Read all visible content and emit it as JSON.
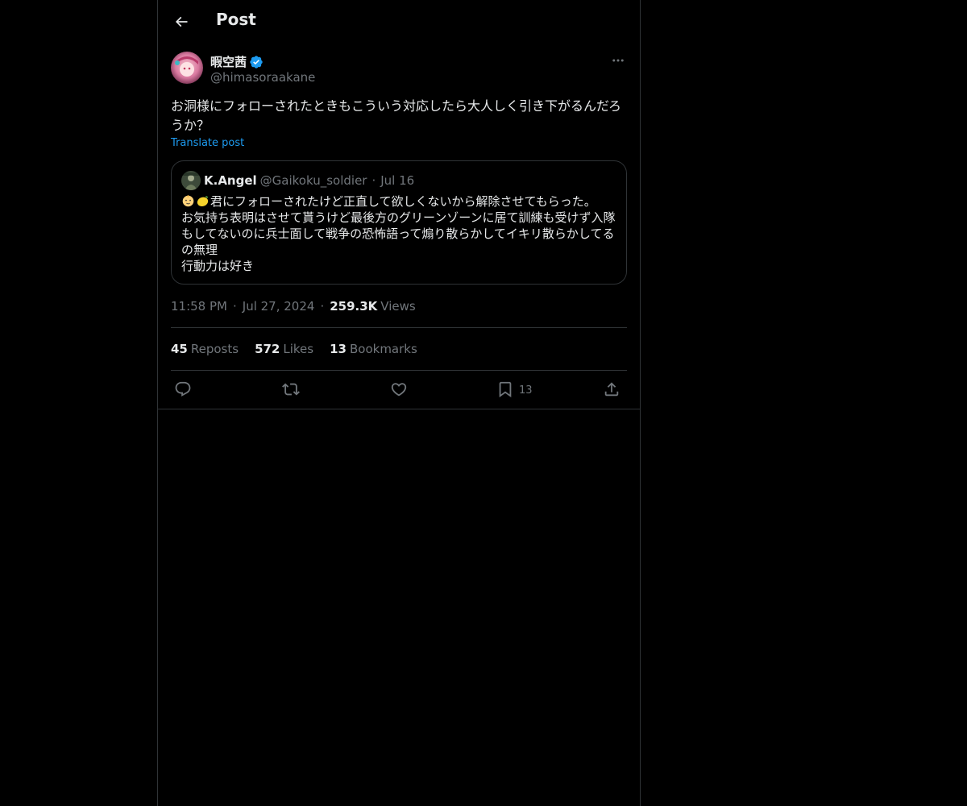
{
  "header": {
    "title": "Post"
  },
  "post": {
    "author_name": "暇空茜",
    "author_handle": "@himasoraakane",
    "text": "お洞様にフォローされたときもこういう対応したら大人しく引き下がるんだろうか？",
    "translate_label": "Translate post",
    "time": "11:58 PM",
    "date": "Jul 27, 2024",
    "views_count": "259.3K",
    "views_label": "Views"
  },
  "quote": {
    "author_name": "K.Angel",
    "author_handle": "@Gaikoku_soldier",
    "date": "Jul 16",
    "lines": [
      "君にフォローされたけど正直して欲しくないから解除させてもらった。",
      "お気持ち表明はさせて貰うけど最後方のグリーンゾーンに居て訓練も受けず入隊もしてないのに兵士面して戦争の恐怖語って煽り散らかしてイキリ散らかしてるの無理",
      "行動力は好き"
    ],
    "emojis": [
      "baby-face-emoji",
      "lemon-emoji"
    ]
  },
  "stats": {
    "reposts_count": "45",
    "reposts_label": "Reposts",
    "likes_count": "572",
    "likes_label": "Likes",
    "bookmarks_count": "13",
    "bookmarks_label": "Bookmarks"
  },
  "actions": {
    "bookmark_count": "13",
    "icons": [
      "reply-icon",
      "repost-icon",
      "like-icon",
      "bookmark-icon",
      "share-icon"
    ]
  },
  "colors": {
    "background": "#000000",
    "text": "#e7e9ea",
    "secondary": "#71767b",
    "accent": "#1d9bf0",
    "border": "#2f3336"
  }
}
